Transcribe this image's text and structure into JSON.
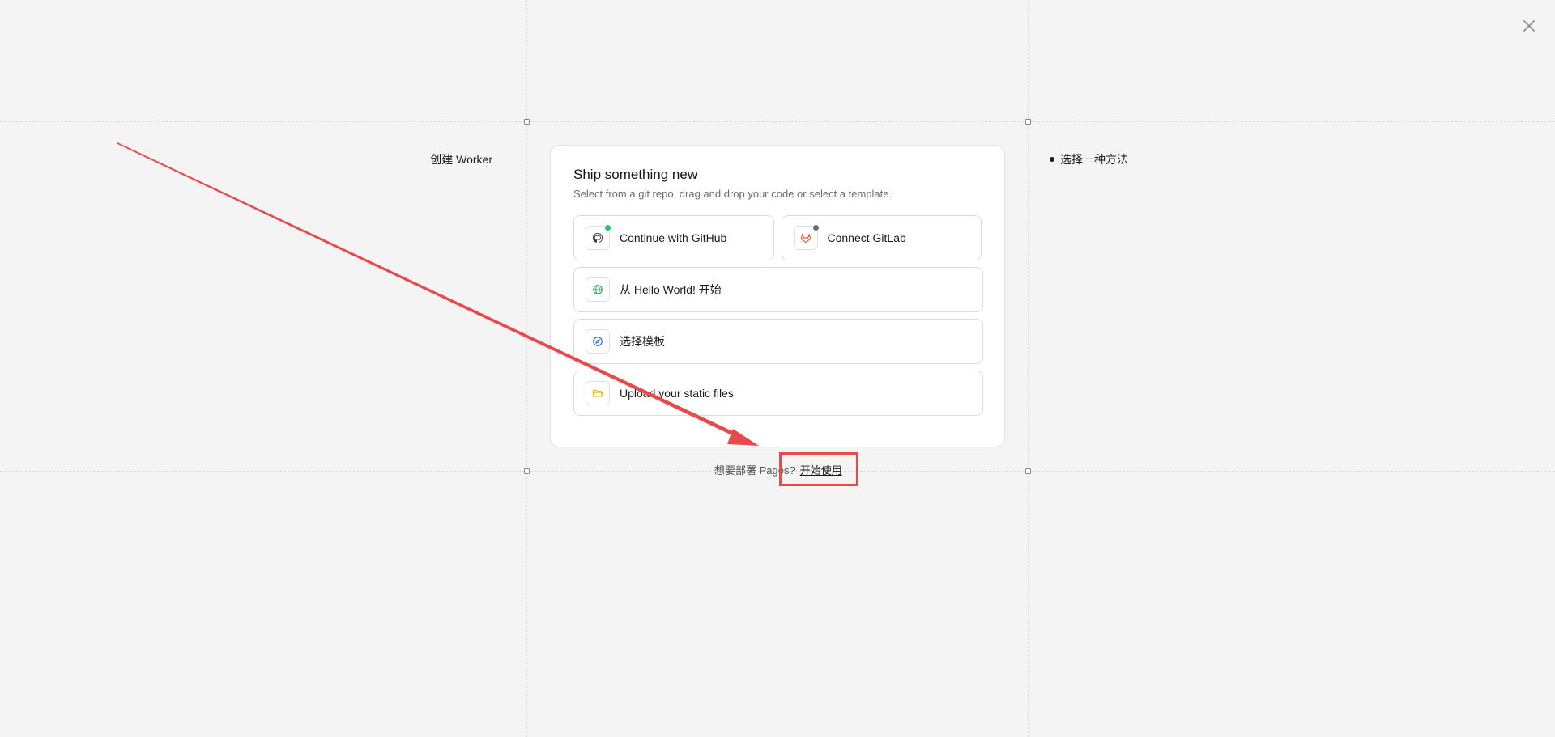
{
  "steps": {
    "left_label": "创建 Worker",
    "right_label": "选择一种方法"
  },
  "card": {
    "title": "Ship something new",
    "subtitle": "Select from a git repo, drag and drop your code or select a template.",
    "options": {
      "github": {
        "label": "Continue with GitHub",
        "icon": "github-icon",
        "status_color": "#22c55e"
      },
      "gitlab": {
        "label": "Connect GitLab",
        "icon": "gitlab-icon",
        "status_color": "#6b6b6b"
      },
      "hello_world": {
        "label": "从 Hello World! 开始",
        "icon": "globe-icon",
        "color": "#16a34a"
      },
      "template": {
        "label": "选择模板",
        "icon": "compass-icon",
        "color": "#2563eb"
      },
      "upload": {
        "label": "Upload your static files",
        "icon": "folder-icon",
        "color": "#eab308"
      }
    }
  },
  "footer": {
    "question": "想要部署 Pages?",
    "link_label": "开始使用"
  },
  "annotation": {
    "color": "#e8494b"
  }
}
